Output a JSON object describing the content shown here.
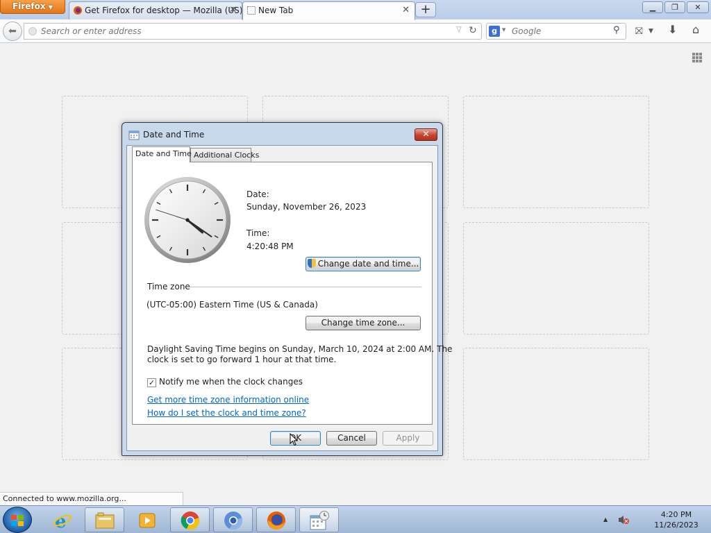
{
  "browser": {
    "menu_label": "Firefox",
    "tabs": [
      {
        "title": "Get Firefox for desktop — Mozilla (US)",
        "active": false
      },
      {
        "title": "New Tab",
        "active": true
      }
    ],
    "new_tab_label": "+",
    "url_placeholder": "Search or enter address",
    "search_placeholder": "Google",
    "status_text": "Connected to www.mozilla.org..."
  },
  "dialog": {
    "title": "Date and Time",
    "tabs": [
      "Date and Time",
      "Additional Clocks"
    ],
    "date_label": "Date:",
    "date_value": "Sunday, November 26, 2023",
    "time_label": "Time:",
    "time_value": "4:20:48 PM",
    "change_datetime_button": "Change date and time...",
    "timezone_heading": "Time zone",
    "timezone_value": "(UTC-05:00) Eastern Time (US & Canada)",
    "change_timezone_button": "Change time zone...",
    "dst_line1": "Daylight Saving Time begins on Sunday, March 10, 2024 at 2:00 AM. The",
    "dst_line2": "clock is set to go forward 1 hour at that time.",
    "notify_label": "Notify me when the clock changes",
    "notify_checked": true,
    "link_more_info": "Get more time zone information online",
    "link_howto": "How do I set the clock and time zone?",
    "ok_button": "OK",
    "cancel_button": "Cancel",
    "apply_button": "Apply"
  },
  "clock_face": {
    "hours": 4,
    "minutes": 20,
    "seconds": 48
  },
  "taskbar": {
    "apps": [
      "internet-explorer",
      "windows-explorer",
      "media-player",
      "chrome",
      "chromium",
      "firefox",
      "date-time-control-panel"
    ],
    "clock_time": "4:20 PM",
    "clock_date": "11/26/2023"
  },
  "colors": {
    "link": "#0066cc",
    "firefox_orange": "#e3761b",
    "dialog_frame": "#c9d9ec",
    "close_red": "#c4442f"
  }
}
